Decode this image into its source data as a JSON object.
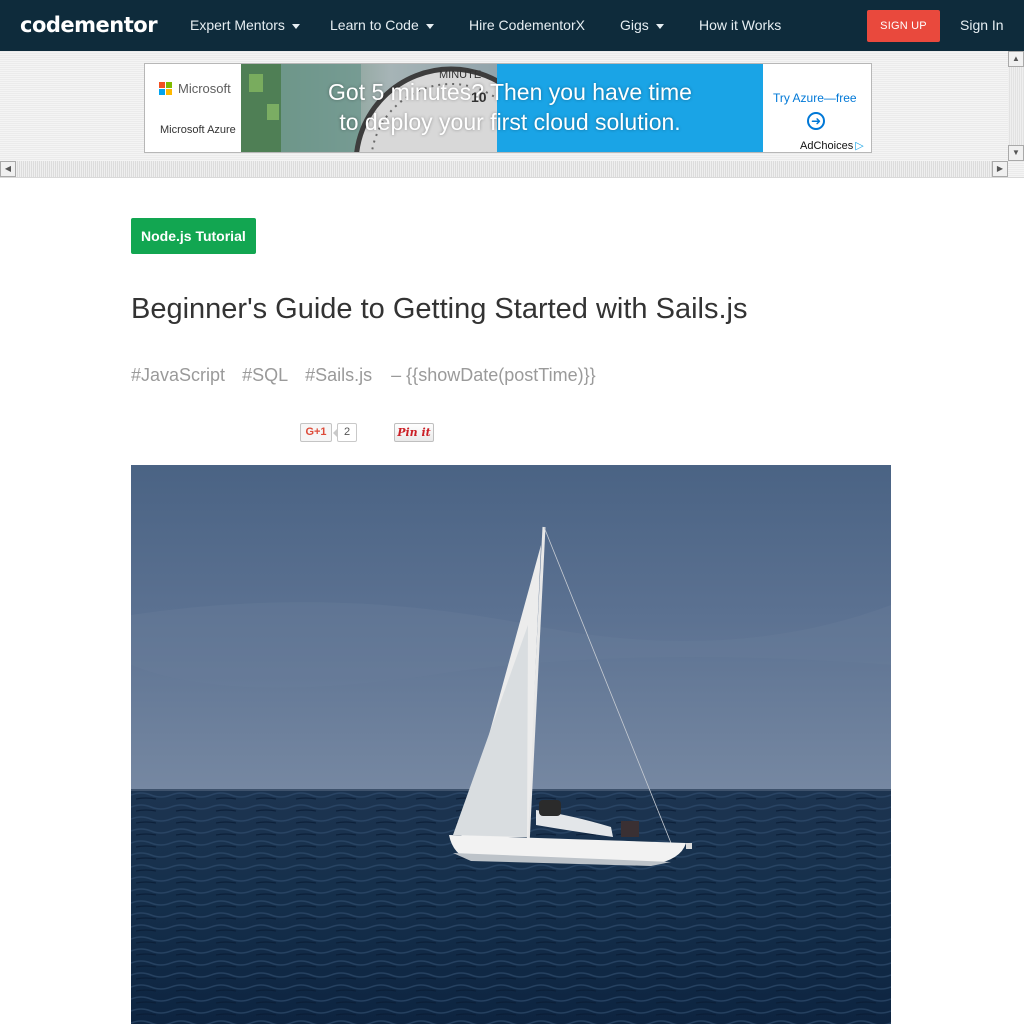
{
  "nav": {
    "logo": "codementor",
    "items": [
      {
        "label": "Expert Mentors",
        "caret": true
      },
      {
        "label": "Learn to Code",
        "caret": true
      },
      {
        "label": "Hire CodementorX",
        "caret": false
      },
      {
        "label": "Gigs",
        "caret": true
      },
      {
        "label": "How it Works",
        "caret": false
      }
    ],
    "signup": "SIGN UP",
    "signin": "Sign In"
  },
  "ad": {
    "brand": "Microsoft",
    "product": "Microsoft Azure",
    "headline_line1": "Got 5 minutes? Then you have time",
    "headline_line2": "to deploy your first cloud solution.",
    "cta": "Try Azure—free",
    "adchoices": "AdChoices",
    "ms_colors": [
      "#f25022",
      "#7fba00",
      "#00a4ef",
      "#ffb900"
    ],
    "accent": "#1aa4e6"
  },
  "article": {
    "category": "Node.js Tutorial",
    "title": "Beginner's Guide to Getting Started with Sails.js",
    "tags": [
      "#JavaScript",
      "#SQL",
      "#Sails.js"
    ],
    "date": "– {{showDate(postTime)}}",
    "share": {
      "gplus_label": "G+1",
      "gplus_count": "2",
      "pinit_label": "Pin it"
    },
    "hero_alt": "Sailboat on the sea"
  },
  "colors": {
    "navbar": "#0e2b3b",
    "signup": "#e9493d",
    "category": "#12a651"
  }
}
